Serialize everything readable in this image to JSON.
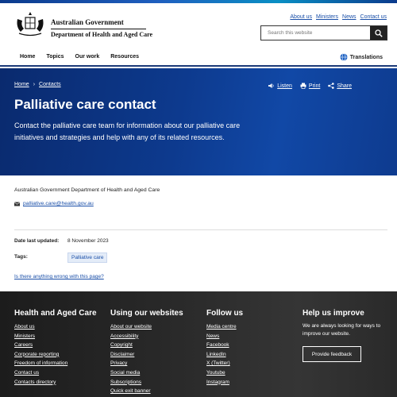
{
  "header": {
    "gov_name": "Australian Government",
    "dept_name": "Department of Health and Aged Care",
    "utility_links": [
      "About us",
      "Ministers",
      "News",
      "Contact us"
    ],
    "search_placeholder": "Search this website"
  },
  "nav": {
    "items": [
      "Home",
      "Topics",
      "Our work",
      "Resources"
    ],
    "translations": "Translations"
  },
  "hero": {
    "breadcrumb": [
      "Home",
      "Contacts"
    ],
    "breadcrumb_separator": "›",
    "actions": {
      "listen": "Listen",
      "print": "Print",
      "share": "Share"
    },
    "title": "Palliative care contact",
    "intro": "Contact the palliative care team for information about our palliative care initiatives and strategies and help with any of its related resources."
  },
  "contact": {
    "org": "Australian Government Department of Health and Aged Care",
    "email": "palliative.care@health.gov.au"
  },
  "meta": {
    "date_label": "Date last updated:",
    "date_value": "8 November 2023",
    "tags_label": "Tags:",
    "tag": "Palliative care",
    "feedback_link": "Is there anything wrong with this page?"
  },
  "footer": {
    "col1": {
      "title": "Health and Aged Care",
      "links": [
        "About us",
        "Ministers",
        "Careers",
        "Corporate reporting",
        "Freedom of information",
        "Contact us",
        "Contacts directory"
      ]
    },
    "col2": {
      "title": "Using our websites",
      "links": [
        "About our website",
        "Accessibility",
        "Copyright",
        "Disclaimer",
        "Privacy",
        "Social media",
        "Subscriptions",
        "Quick exit banner"
      ]
    },
    "col3": {
      "title": "Follow us",
      "links": [
        "Media centre",
        "News",
        "Facebook",
        "LinkedIn",
        "X (Twitter)",
        "Youtube",
        "Instagram"
      ]
    },
    "col4": {
      "title": "Help us improve",
      "text": "We are always looking for ways to improve our website.",
      "button": "Provide feedback"
    }
  },
  "colors": {
    "hero": "#0d3a8e",
    "link": "#1a4fa8",
    "footer": "#2a2a2a"
  }
}
